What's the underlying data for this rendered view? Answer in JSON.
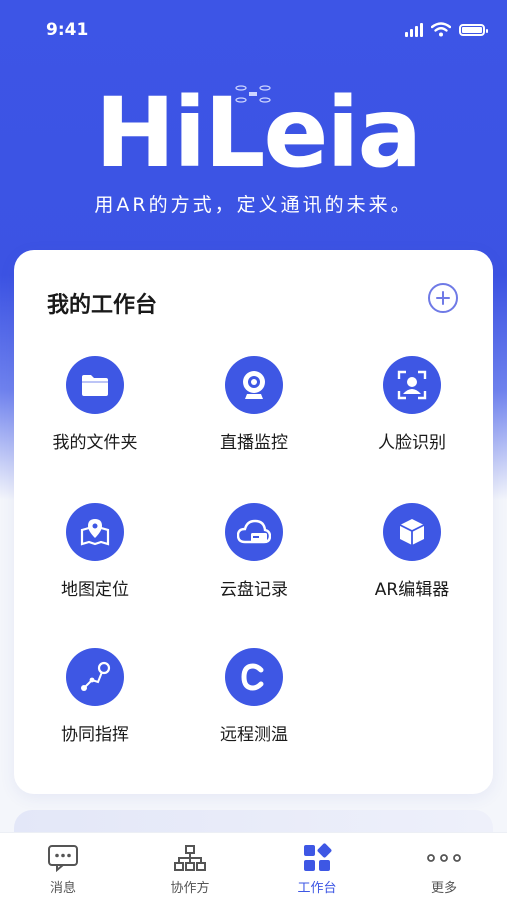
{
  "status_bar": {
    "time": "9:41"
  },
  "header": {
    "logo_text": "HiLeia",
    "tagline": "用AR的方式，定义通讯的未来。"
  },
  "workspace": {
    "title": "我的工作台",
    "tiles": [
      {
        "label": "我的文件夹",
        "icon": "folder-icon"
      },
      {
        "label": "直播监控",
        "icon": "webcam-icon"
      },
      {
        "label": "人脸识别",
        "icon": "face-scan-icon"
      },
      {
        "label": "地图定位",
        "icon": "map-pin-icon"
      },
      {
        "label": "云盘记录",
        "icon": "cloud-drive-icon"
      },
      {
        "label": "AR编辑器",
        "icon": "cube-icon"
      },
      {
        "label": "协同指挥",
        "icon": "route-icon"
      },
      {
        "label": "远程测温",
        "icon": "thermometer-c-icon"
      }
    ]
  },
  "tabbar": {
    "active_index": 2,
    "items": [
      {
        "label": "消息",
        "icon": "message-icon"
      },
      {
        "label": "协作方",
        "icon": "org-chart-icon"
      },
      {
        "label": "工作台",
        "icon": "grid-icon"
      },
      {
        "label": "更多",
        "icon": "more-icon"
      }
    ]
  },
  "colors": {
    "primary": "#3E57E4",
    "hero_bg": "#3D55E6",
    "background": "#F4F6FB"
  }
}
